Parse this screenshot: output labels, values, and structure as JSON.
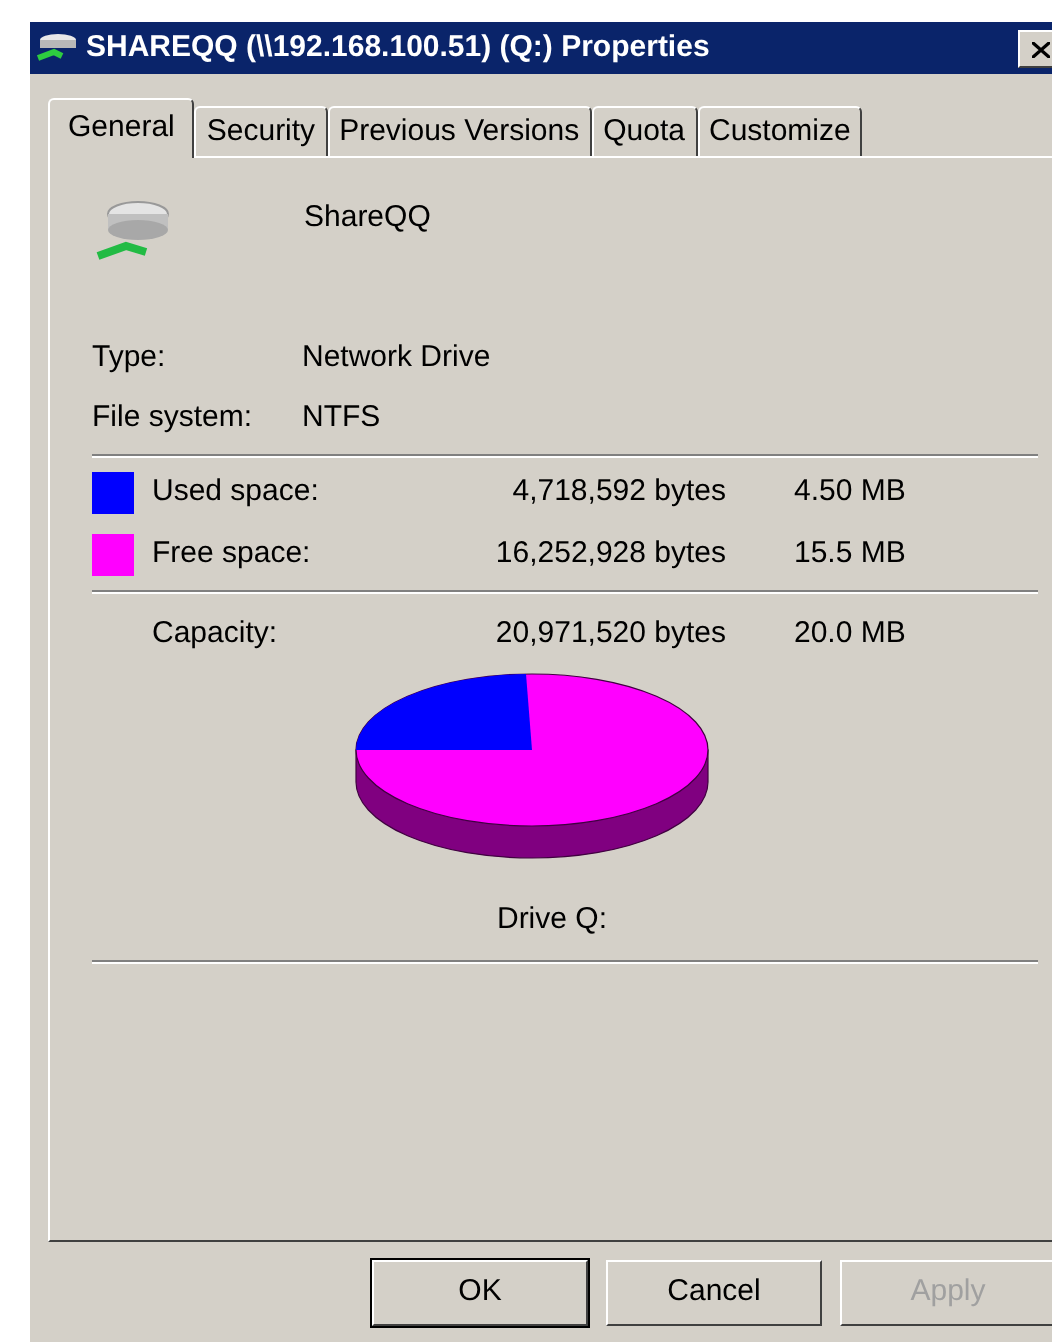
{
  "window": {
    "title": "SHAREQQ (\\\\192.168.100.51) (Q:) Properties"
  },
  "tabs": [
    {
      "label": "General",
      "selected": true
    },
    {
      "label": "Security",
      "selected": false
    },
    {
      "label": "Previous Versions",
      "selected": false
    },
    {
      "label": "Quota",
      "selected": false
    },
    {
      "label": "Customize",
      "selected": false
    }
  ],
  "drive_name": "ShareQQ",
  "properties": [
    {
      "label": "Type:",
      "value": "Network Drive"
    },
    {
      "label": "File system:",
      "value": "NTFS"
    }
  ],
  "space": [
    {
      "label": "Used space:",
      "bytes": "4,718,592 bytes",
      "size": "4.50 MB",
      "color": "#0000ff"
    },
    {
      "label": "Free space:",
      "bytes": "16,252,928 bytes",
      "size": "15.5 MB",
      "color": "#ff00ff"
    }
  ],
  "capacity": {
    "label": "Capacity:",
    "bytes": "20,971,520 bytes",
    "size": "20.0 MB"
  },
  "drive_label": "Drive Q:",
  "buttons": [
    {
      "label": "OK",
      "disabled": false,
      "default": true
    },
    {
      "label": "Cancel",
      "disabled": false,
      "default": false
    },
    {
      "label": "Apply",
      "disabled": true,
      "default": false
    }
  ]
}
